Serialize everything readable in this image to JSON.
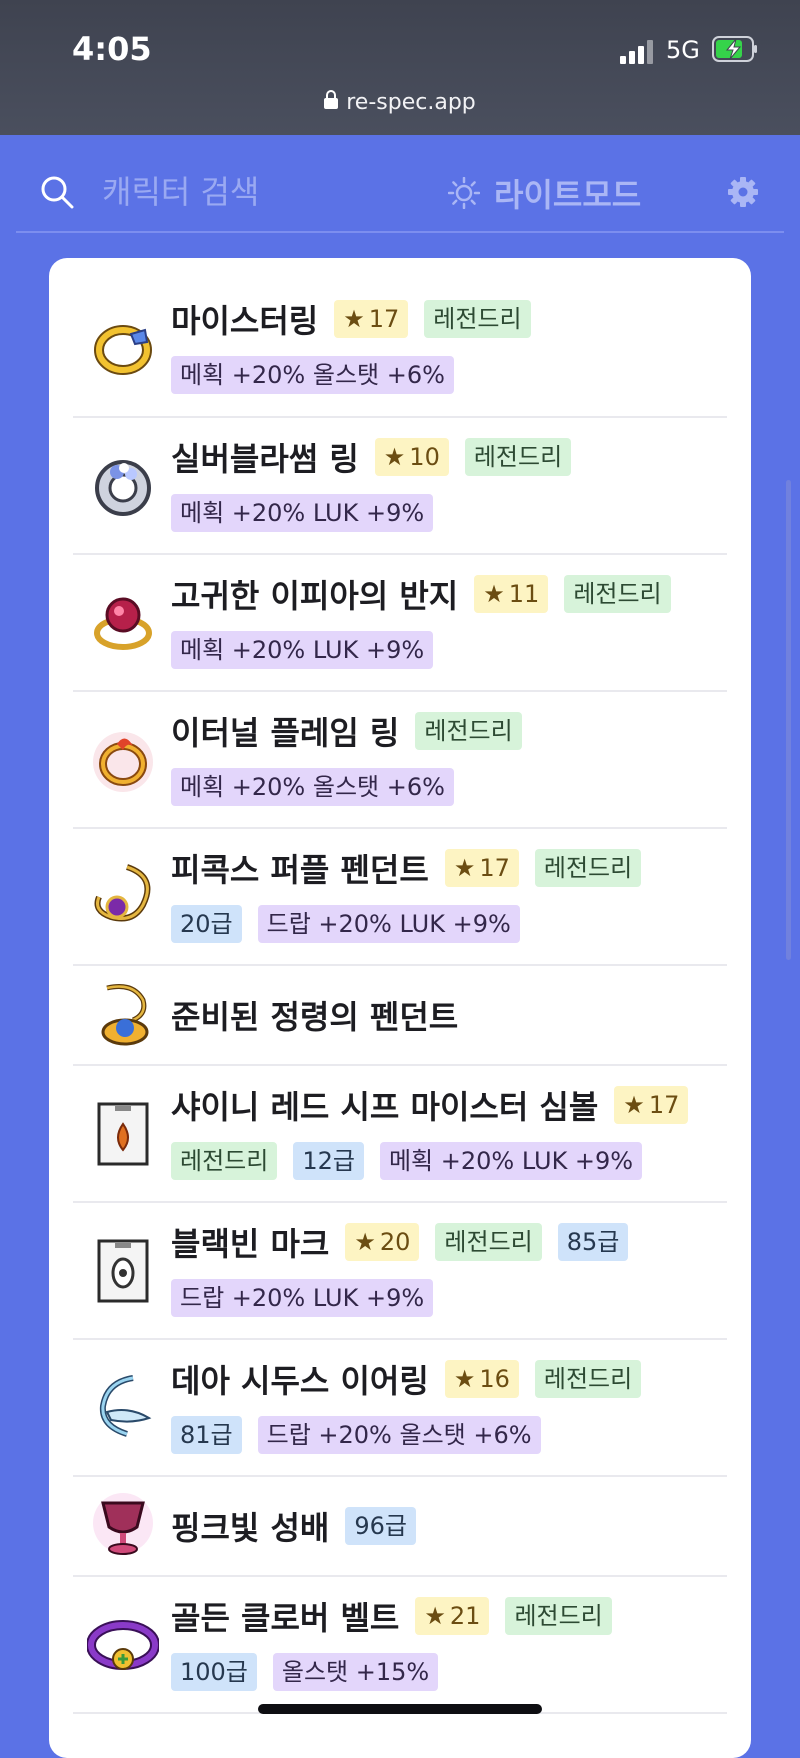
{
  "status_bar": {
    "time": "4:05",
    "network": "5G",
    "url": "re-spec.app"
  },
  "app_bar": {
    "search_placeholder": "캐릭터 검색",
    "mode_label": "라이트모드"
  },
  "items": [
    {
      "name": "마이스터링",
      "icon": "meister-ring-icon",
      "title_badges": [
        {
          "type": "star",
          "text": "17"
        },
        {
          "type": "legend",
          "text": "레전드리"
        }
      ],
      "tags": [
        {
          "type": "potential",
          "text": "메획 +20% 올스탯 +6%"
        }
      ]
    },
    {
      "name": "실버블라썸 링",
      "icon": "silver-blossom-ring-icon",
      "title_badges": [
        {
          "type": "star",
          "text": "10"
        },
        {
          "type": "legend",
          "text": "레전드리"
        }
      ],
      "tags": [
        {
          "type": "potential",
          "text": "메획 +20% LUK +9%"
        }
      ]
    },
    {
      "name": "고귀한 이피아의 반지",
      "icon": "ifia-ring-icon",
      "title_badges": [
        {
          "type": "star",
          "text": "11"
        },
        {
          "type": "legend",
          "text": "레전드리"
        }
      ],
      "tags": [
        {
          "type": "potential",
          "text": "메획 +20% LUK +9%"
        }
      ]
    },
    {
      "name": "이터널 플레임 링",
      "icon": "eternal-flame-ring-icon",
      "title_badges": [
        {
          "type": "legend",
          "text": "레전드리"
        }
      ],
      "tags": [
        {
          "type": "potential",
          "text": "메획 +20% 올스탯 +6%"
        }
      ]
    },
    {
      "name": "피콕스 퍼플 펜던트",
      "icon": "purple-pendant-icon",
      "title_badges": [
        {
          "type": "star",
          "text": "17"
        },
        {
          "type": "legend",
          "text": "레전드리"
        }
      ],
      "tags": [
        {
          "type": "grade",
          "text": "20급"
        },
        {
          "type": "potential",
          "text": "드랍 +20% LUK +9%"
        }
      ]
    },
    {
      "name": "준비된 정령의 펜던트",
      "icon": "spirit-pendant-icon",
      "title_badges": [],
      "tags": []
    },
    {
      "name": "샤이니 레드 시프 마이스터 심볼",
      "icon": "meister-symbol-icon",
      "title_badges": [
        {
          "type": "star",
          "text": "17"
        }
      ],
      "tags": [
        {
          "type": "legend",
          "text": "레전드리"
        },
        {
          "type": "grade",
          "text": "12급"
        },
        {
          "type": "potential",
          "text": "메획 +20% LUK +9%"
        }
      ]
    },
    {
      "name": "블랙빈 마크",
      "icon": "blackbean-mark-icon",
      "title_badges": [
        {
          "type": "star",
          "text": "20"
        },
        {
          "type": "legend",
          "text": "레전드리"
        },
        {
          "type": "grade",
          "text": "85급"
        }
      ],
      "tags": [
        {
          "type": "potential",
          "text": "드랍 +20% LUK +9%"
        }
      ]
    },
    {
      "name": "데아 시두스 이어링",
      "icon": "dea-sidus-earring-icon",
      "title_badges": [
        {
          "type": "star",
          "text": "16"
        },
        {
          "type": "legend",
          "text": "레전드리"
        }
      ],
      "tags": [
        {
          "type": "grade",
          "text": "81급"
        },
        {
          "type": "potential",
          "text": "드랍 +20% 올스탯 +6%"
        }
      ]
    },
    {
      "name": "핑크빛 성배",
      "icon": "pink-chalice-icon",
      "title_badges": [
        {
          "type": "grade",
          "text": "96급"
        }
      ],
      "tags": []
    },
    {
      "name": "골든 클로버 벨트",
      "icon": "golden-clover-belt-icon",
      "title_badges": [
        {
          "type": "star",
          "text": "21"
        },
        {
          "type": "legend",
          "text": "레전드리"
        }
      ],
      "tags": [
        {
          "type": "grade",
          "text": "100급"
        },
        {
          "type": "potential",
          "text": "올스탯 +15%"
        }
      ]
    }
  ]
}
